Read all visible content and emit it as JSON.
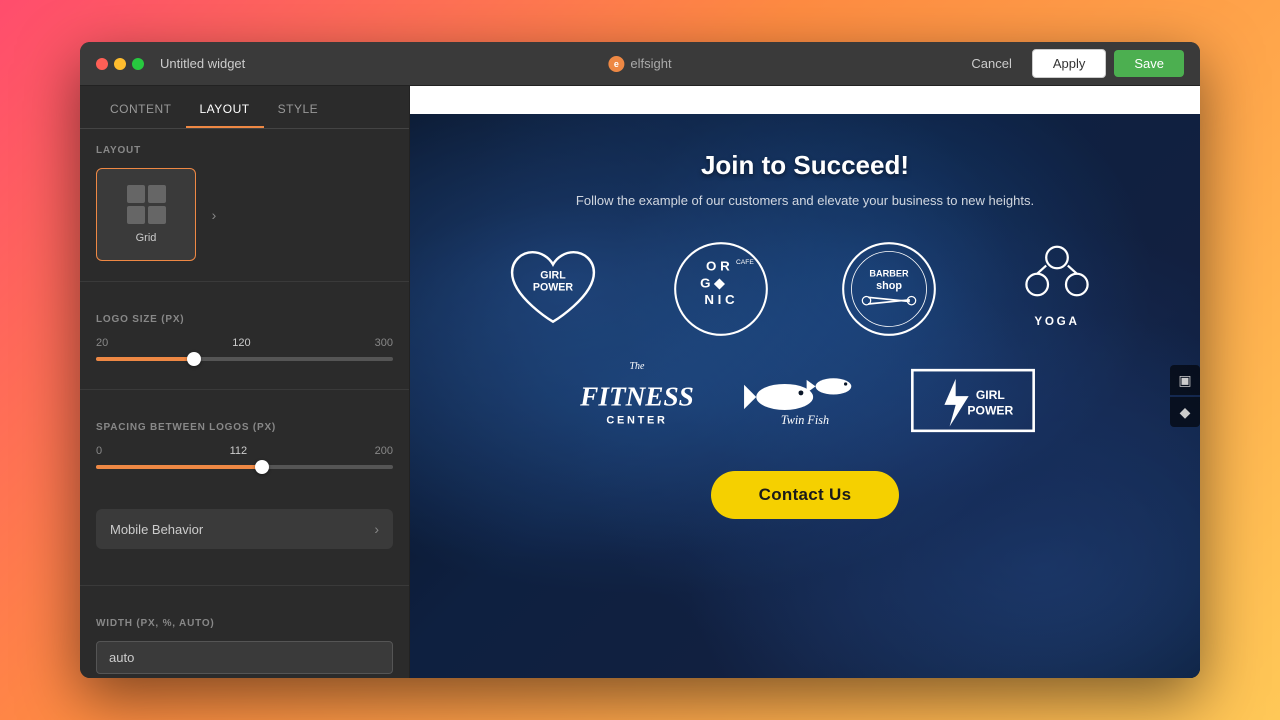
{
  "window": {
    "title": "Untitled widget",
    "traffic_lights": [
      "red",
      "yellow",
      "green"
    ]
  },
  "header": {
    "brand": "elfsight",
    "cancel_label": "Cancel",
    "apply_label": "Apply",
    "save_label": "Save"
  },
  "sidebar": {
    "tabs": [
      {
        "id": "content",
        "label": "CONTENT"
      },
      {
        "id": "layout",
        "label": "LAYOUT",
        "active": true
      },
      {
        "id": "style",
        "label": "STYLE"
      }
    ],
    "layout_section": {
      "label": "LAYOUT",
      "options": [
        {
          "id": "grid",
          "label": "Grid",
          "selected": true
        }
      ]
    },
    "logo_size": {
      "label": "LOGO SIZE (PX)",
      "min": 20,
      "max": 300,
      "current": 120,
      "fill_pct": 33
    },
    "spacing": {
      "label": "SPACING BETWEEN LOGOS (PX)",
      "min": 0,
      "max": 200,
      "current": 112,
      "fill_pct": 56
    },
    "mobile_behavior": {
      "label": "Mobile Behavior"
    },
    "width": {
      "label": "WIDTH (PX, %, AUTO)",
      "value": "auto"
    }
  },
  "preview": {
    "hero": {
      "title": "Join to Succeed!",
      "subtitle": "Follow the example of our customers and elevate your business to new heights."
    },
    "logos": [
      {
        "id": "girl-power-heart",
        "row": 1
      },
      {
        "id": "organic-cafe",
        "row": 1
      },
      {
        "id": "barber-shop",
        "row": 1
      },
      {
        "id": "yoga",
        "row": 1
      },
      {
        "id": "fitness-center",
        "row": 2
      },
      {
        "id": "twin-fish",
        "row": 2
      },
      {
        "id": "girl-power-box",
        "row": 2
      }
    ],
    "cta": {
      "label": "Contact Us"
    }
  },
  "side_controls": [
    {
      "id": "monitor",
      "icon": "▣"
    },
    {
      "id": "diamond",
      "icon": "◆"
    }
  ]
}
